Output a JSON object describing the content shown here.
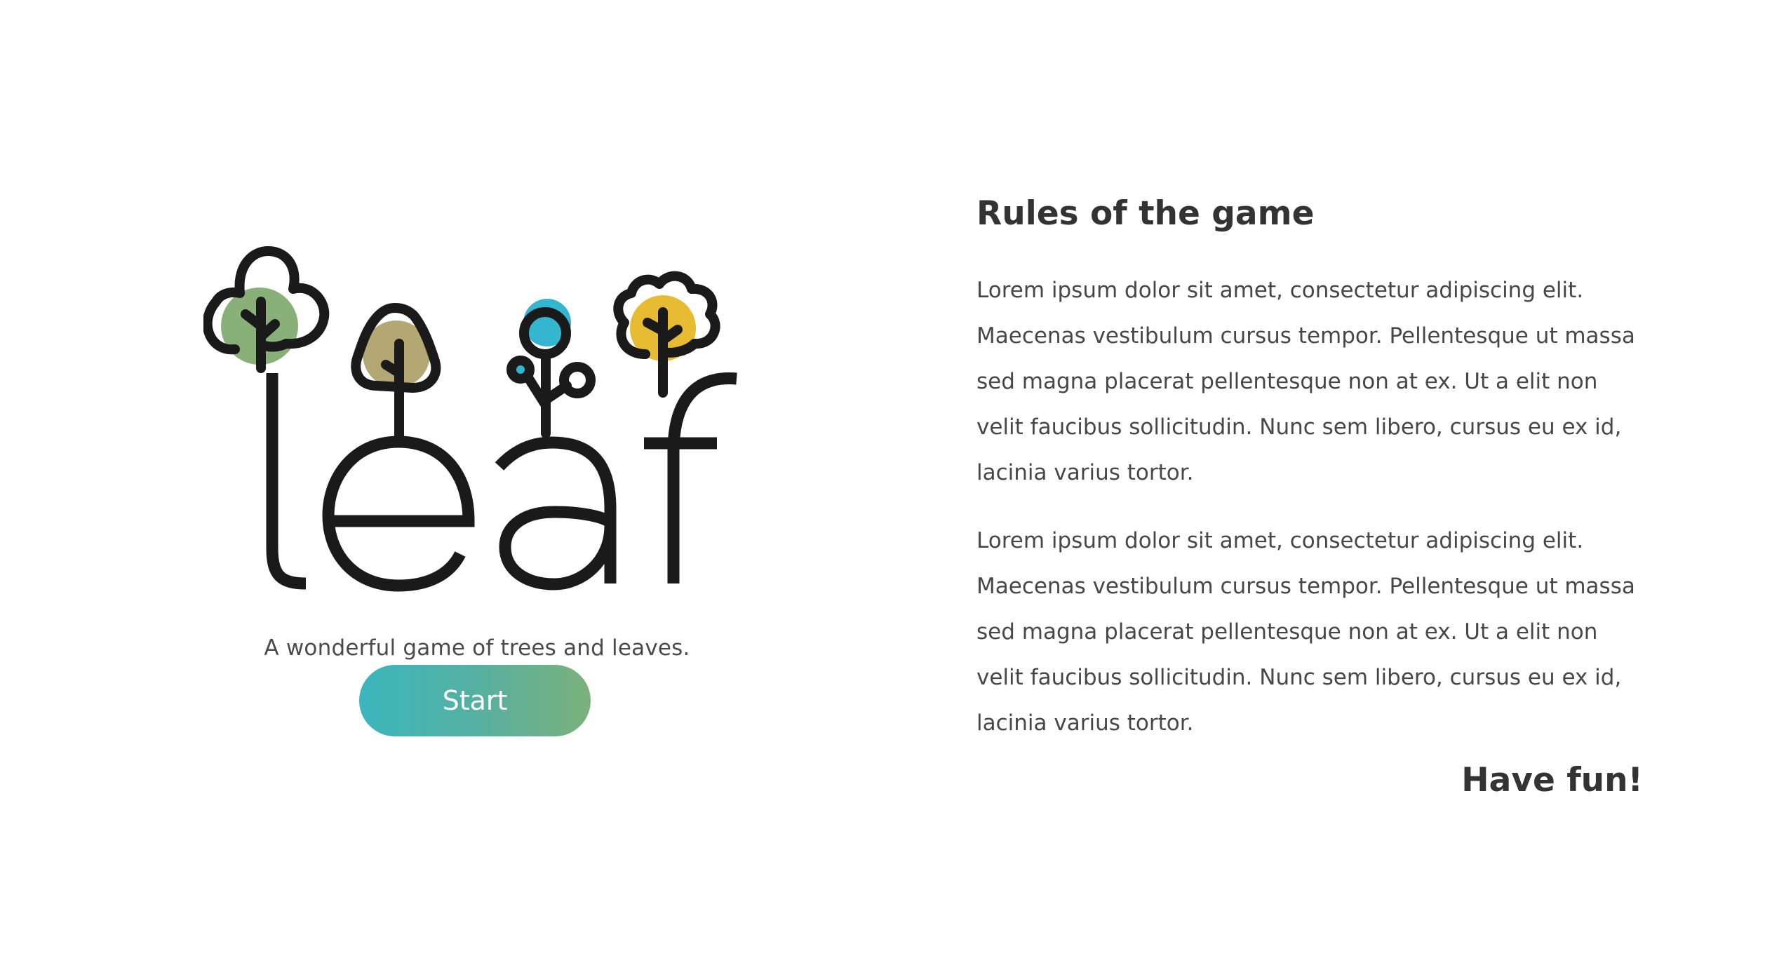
{
  "hero": {
    "logo_text": "leaf",
    "tagline": "A wonderful game of trees and leaves.",
    "start_label": "Start"
  },
  "rules": {
    "title": "Rules of the game",
    "paragraphs": [
      "Lorem ipsum dolor sit amet, consectetur adipiscing elit. Maecenas vestibulum cursus tempor. Pellentesque ut massa sed magna placerat pellentesque non at ex. Ut a elit non velit faucibus sollicitudin. Nunc sem libero, cursus eu ex id, lacinia varius tortor.",
      "Lorem ipsum dolor sit amet, consectetur adipiscing elit. Maecenas vestibulum cursus tempor. Pellentesque ut massa sed magna placerat pellentesque non at ex. Ut a elit non velit faucibus sollicitudin. Nunc sem libero, cursus eu ex id, lacinia varius tortor."
    ],
    "closing": "Have fun!"
  },
  "colors": {
    "tree_green": "#8ab07a",
    "tree_olive": "#b3a774",
    "tree_cyan": "#35b6d0",
    "tree_yellow": "#e8bc32",
    "ink": "#1a1a1a",
    "button_gradient_start": "#3ab6bd",
    "button_gradient_end": "#7bb17c"
  },
  "icons": [
    "tree-icon-green",
    "tree-icon-olive",
    "tree-icon-cyan",
    "tree-icon-yellow"
  ]
}
